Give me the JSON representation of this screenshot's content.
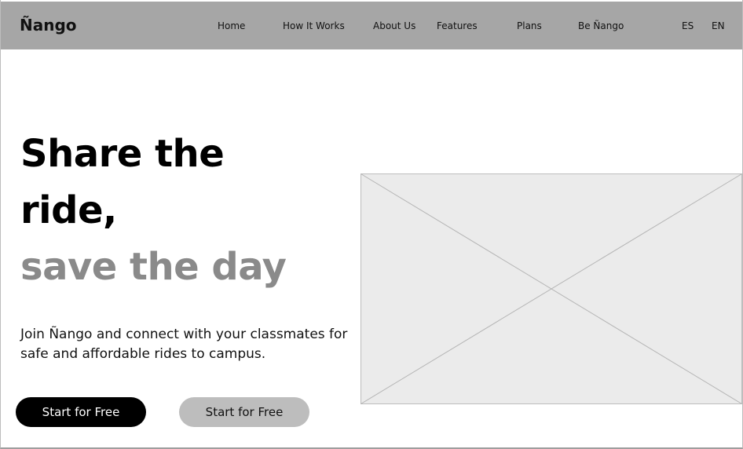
{
  "brand": {
    "logo_text": "Ñango"
  },
  "nav": {
    "home": "Home",
    "how_it_works": "How It Works",
    "about_us": "About Us",
    "features": "Features",
    "plans": "Plans",
    "be_nango": "Be Ñango"
  },
  "languages": {
    "es": "ES",
    "en": "EN"
  },
  "hero": {
    "title_line1": "Share the",
    "title_line2": "ride,",
    "title_line3": "save the day",
    "subtitle": "Join Ñango and connect with your classmates for safe and affordable rides to campus.",
    "primary_cta": "Start for Free",
    "secondary_cta": "Start for Free"
  },
  "colors": {
    "navbar_bg": "#a6a6a6",
    "title_accent_grey": "#8a8a8a",
    "primary_button_bg": "#000000",
    "secondary_button_bg": "#bdbdbd",
    "placeholder_bg": "#ebebeb"
  },
  "icons": {
    "hero_image": "image-placeholder"
  }
}
